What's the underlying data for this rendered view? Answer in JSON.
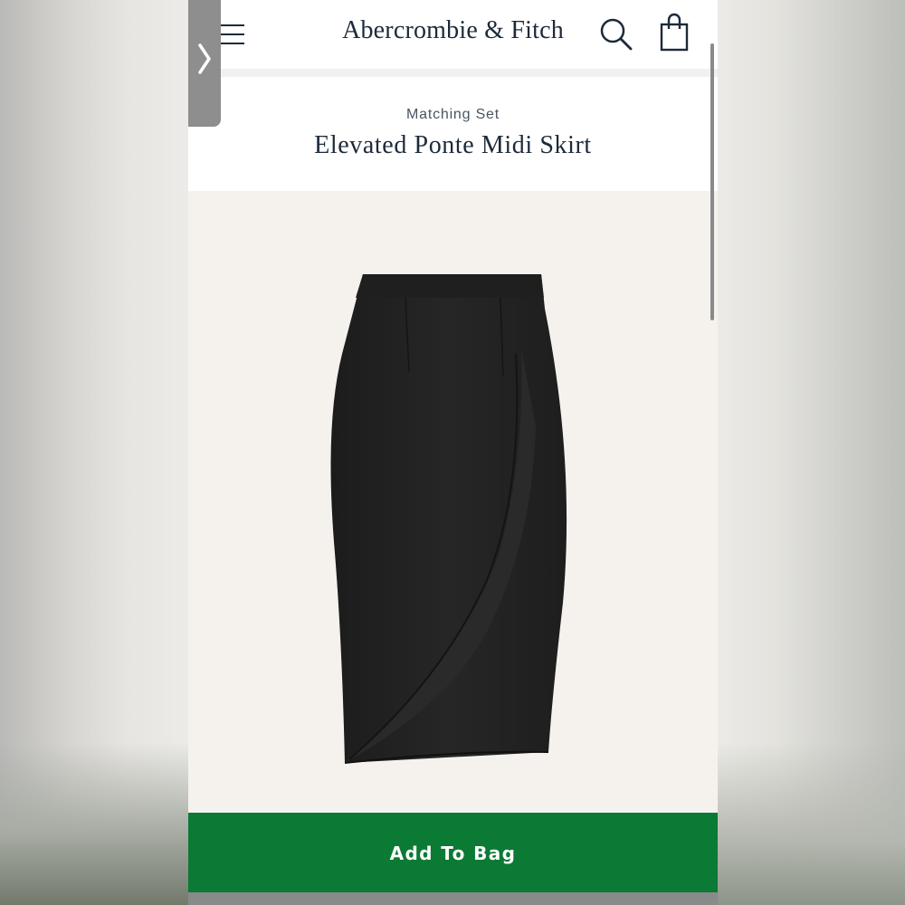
{
  "header": {
    "brand": "Abercrombie & Fitch",
    "menu_icon": "hamburger-menu-icon",
    "search_icon": "search-icon",
    "bag_icon": "shopping-bag-icon"
  },
  "side_tab": {
    "icon": "chevron-right-icon"
  },
  "product": {
    "eyebrow": "Matching Set",
    "title": "Elevated Ponte Midi Skirt",
    "image": "black-wrap-midi-skirt"
  },
  "cta": {
    "label": "Add To Bag"
  },
  "colors": {
    "brand_text": "#1d2a3a",
    "cta_green": "#0a7a34",
    "image_bg": "#f5f2ee",
    "skirt": "#222222"
  }
}
